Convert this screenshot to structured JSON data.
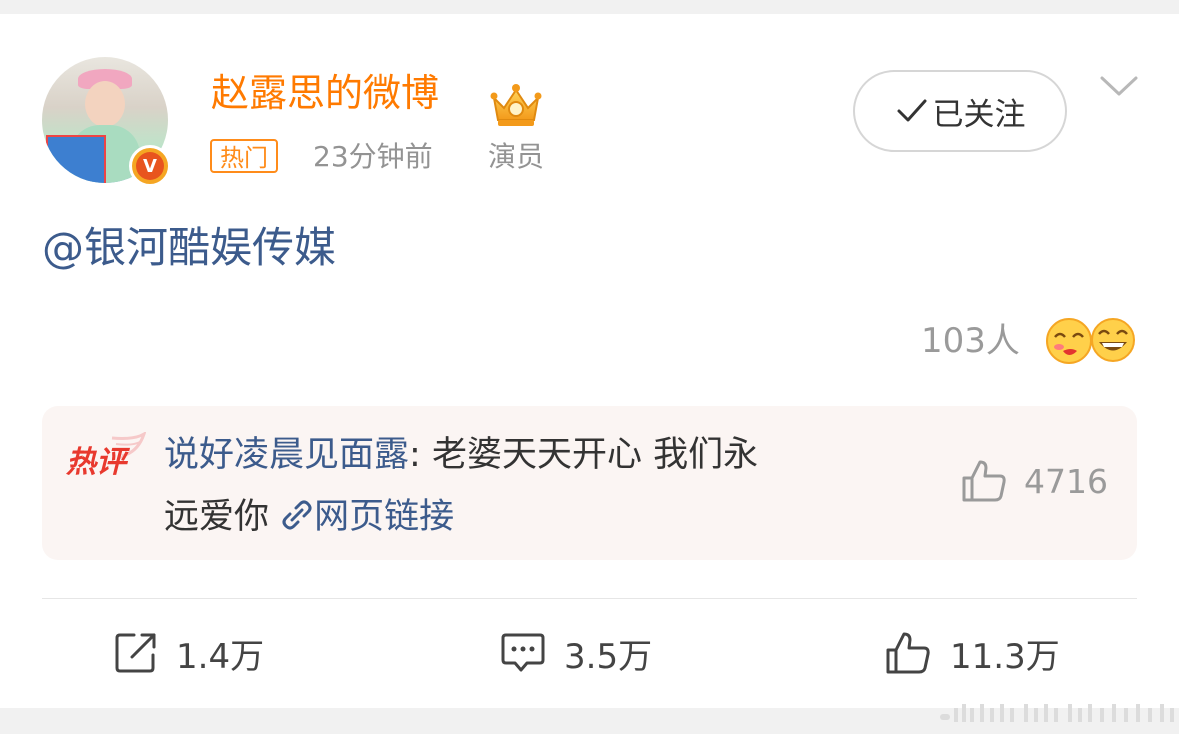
{
  "post": {
    "username": "赵露思的微博",
    "hot_tag": "热门",
    "time": "23分钟前",
    "role": "演员",
    "follow_label": "已关注",
    "content": "@银河酷娱传媒",
    "reactions_text": "103人"
  },
  "hot_comment": {
    "commenter": "说好凌晨见面露",
    "separator": ": ",
    "text_part1": "老婆天天开心 我们永",
    "text_part2": "远爱你 ",
    "link_label": "网页链接",
    "likes": "4716"
  },
  "actions": {
    "repost": "1.4万",
    "comment": "3.5万",
    "like": "11.3万"
  },
  "colors": {
    "username": "#ff7a00",
    "link": "#3c5b8c",
    "meta": "#939393",
    "hot_comment_bg": "#fbf5f3"
  },
  "icons": [
    "verified-v-icon",
    "crown-icon",
    "check-icon",
    "chevron-down-icon",
    "hot-review-label",
    "link-icon",
    "thumbs-up-icon",
    "repost-icon",
    "comment-icon"
  ]
}
